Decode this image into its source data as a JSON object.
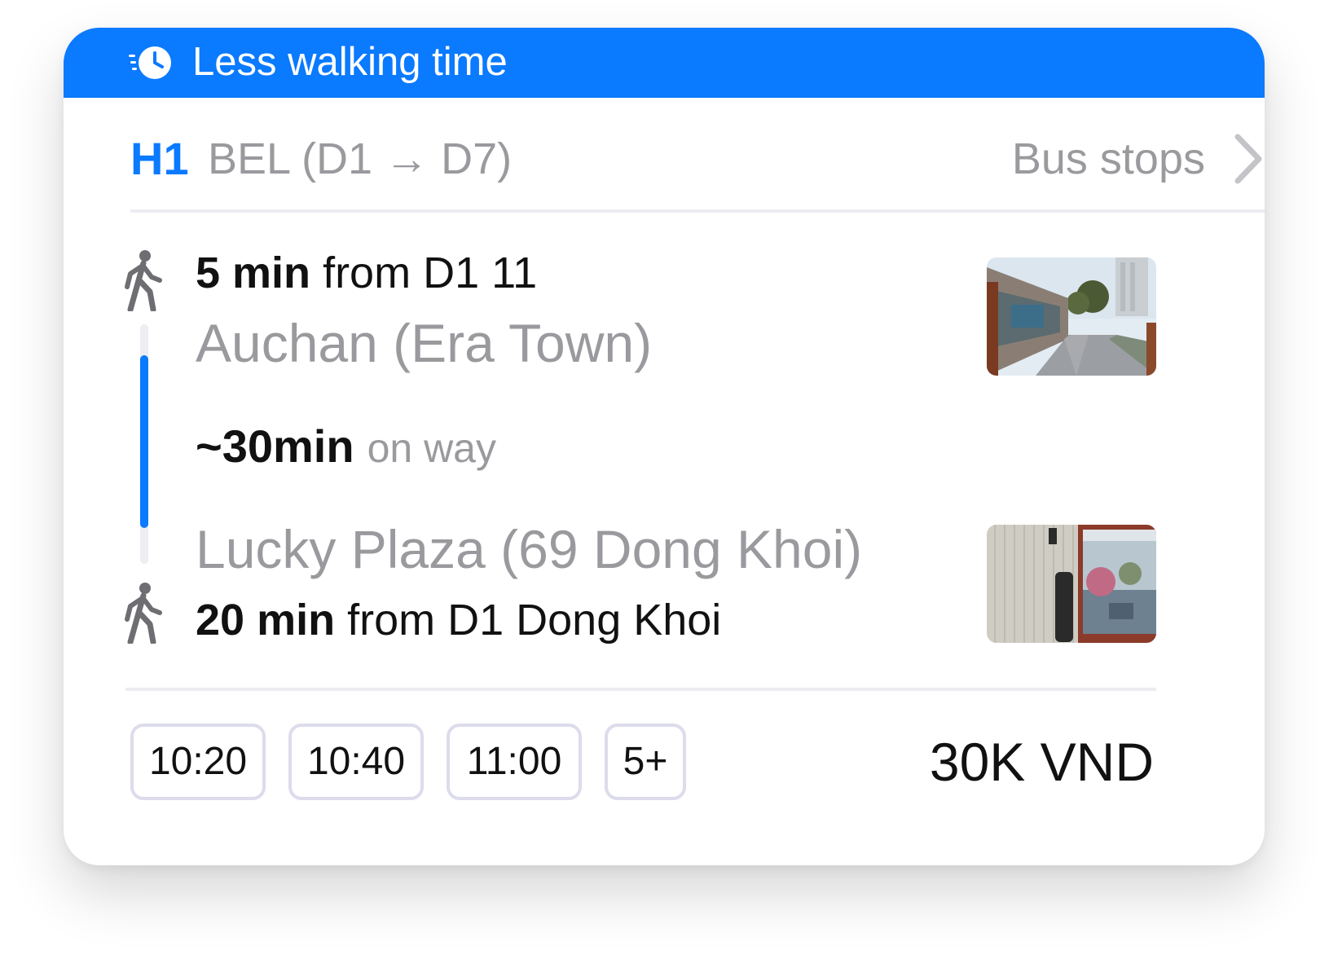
{
  "colors": {
    "accent": "#0a7aff",
    "banner_background": "#0a7aff",
    "muted_text": "#9a9a9e",
    "primary_text": "#111111",
    "divider": "#ececf2",
    "chip_border": "#dcdcec",
    "track_inactive": "#eeeef2"
  },
  "banner": {
    "icon": "fast-clock-icon",
    "label": "Less walking time"
  },
  "route": {
    "code": "H1",
    "name": "BEL (D1 → D7)",
    "bus_stops_label": "Bus stops",
    "bus_stops_icon": "chevron-right-icon"
  },
  "trip": {
    "start_walk": {
      "icon": "walking-person-icon",
      "duration": "5 min",
      "from_text": "from D1 11"
    },
    "start_stop": {
      "name": "Auchan (Era Town)",
      "thumbnail": "street-view-photo"
    },
    "ride": {
      "duration": "~30min",
      "suffix": "on way"
    },
    "end_stop": {
      "name": "Lucky Plaza (69 Dong Khoi)",
      "thumbnail": "bus-stop-photo"
    },
    "end_walk": {
      "icon": "walking-person-icon",
      "duration": "20 min",
      "from_text": "from D1 Dong Khoi"
    }
  },
  "departures": [
    "10:20",
    "10:40",
    "11:00"
  ],
  "more_departures_label": "5+",
  "price": "30K VND"
}
